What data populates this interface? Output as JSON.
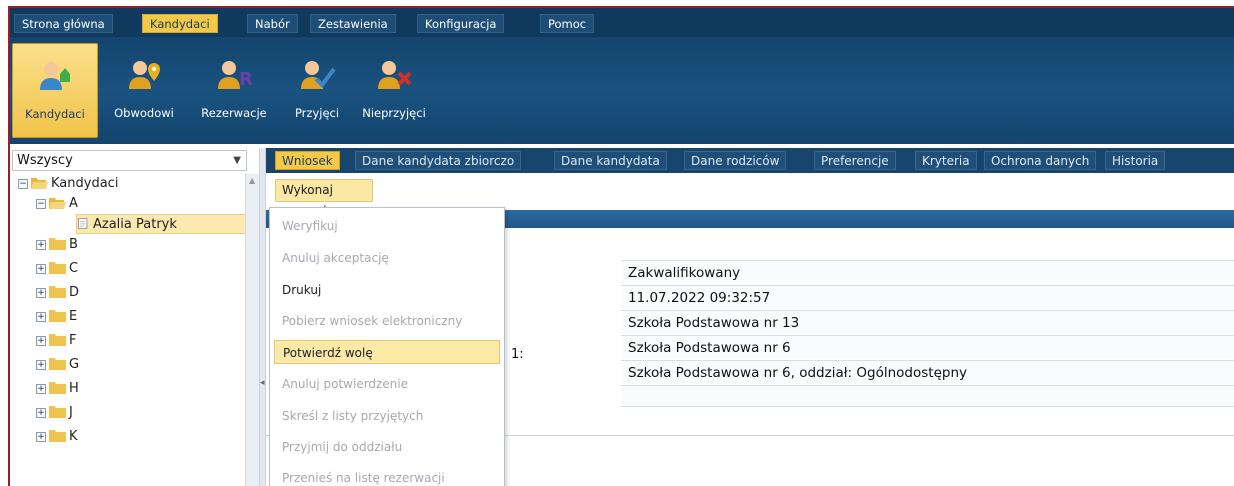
{
  "menu": {
    "items": [
      {
        "label": "Strona główna"
      },
      {
        "label": "Kandydaci"
      },
      {
        "label": "Nabór"
      },
      {
        "label": "Zestawienia"
      },
      {
        "label": "Konfiguracja"
      },
      {
        "label": "Pomoc"
      }
    ],
    "active": "Kandydaci"
  },
  "ribbon": {
    "buttons": [
      {
        "label": "Kandydaci",
        "icon": "person-up-icon"
      },
      {
        "label": "Obwodowi",
        "icon": "person-pin-icon"
      },
      {
        "label": "Rezerwacje",
        "icon": "person-r-icon"
      },
      {
        "label": "Przyjęci",
        "icon": "person-check-icon"
      },
      {
        "label": "Nieprzyjęci",
        "icon": "person-x-icon"
      }
    ]
  },
  "left": {
    "filter": "Wszyscy",
    "tree": {
      "root": "Kandydaci",
      "folders": [
        "A",
        "B",
        "C",
        "D",
        "E",
        "F",
        "G",
        "H",
        "J",
        "K"
      ],
      "selected_item": "Azalia Patryk"
    }
  },
  "tabs": [
    "Wniosek",
    "Dane kandydata zbiorczo",
    "Dane kandydata",
    "Dane rodziców",
    "Preferencje",
    "Kryteria",
    "Ochrona danych",
    "Historia"
  ],
  "operations": {
    "button": "Wykonaj operację",
    "items": [
      {
        "label": "Weryfikuj",
        "enabled": false
      },
      {
        "label": "Anuluj akceptację",
        "enabled": false
      },
      {
        "label": "Drukuj",
        "enabled": true
      },
      {
        "label": "Pobierz wniosek elektroniczny",
        "enabled": false
      },
      {
        "label": "Potwierdź wolę",
        "enabled": true
      },
      {
        "label": "Anuluj potwierdzenie",
        "enabled": false
      },
      {
        "label": "Skreśl z listy przyjętych",
        "enabled": false
      },
      {
        "label": "Przyjmij do oddziału",
        "enabled": false
      },
      {
        "label": "Przenieś na listę rezerwacji",
        "enabled": false
      }
    ]
  },
  "details": {
    "values": [
      "Zakwalifikowany",
      "11.07.2022 09:32:57",
      "Szkoła Podstawowa nr 13",
      "Szkoła Podstawowa nr 6",
      "Szkoła Podstawowa nr 6, oddział: Ogólnodostępny",
      ""
    ],
    "label_fragment": "1:"
  },
  "colors": {
    "accent": "#f3c94a",
    "navy": "#0f3a5e",
    "border": "#9a1d2a"
  }
}
